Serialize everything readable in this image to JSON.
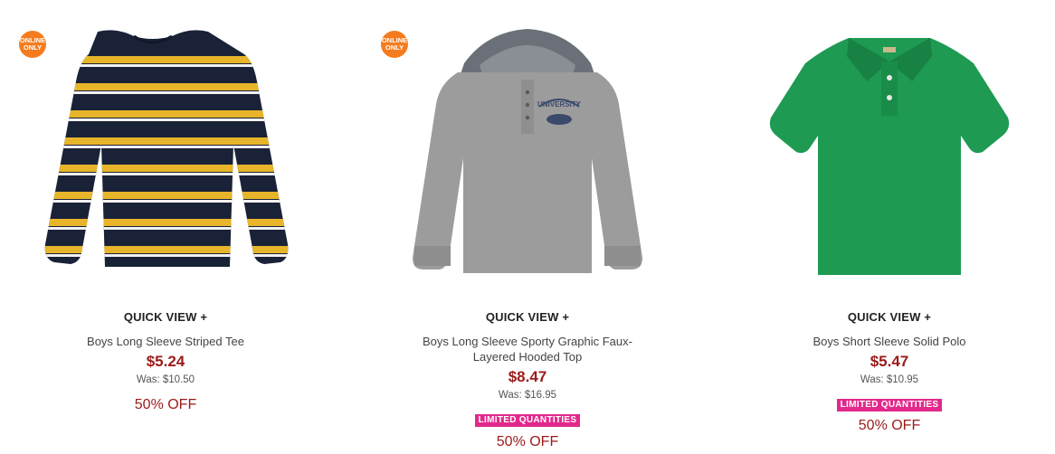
{
  "products": [
    {
      "online_only": "ONLINE ONLY",
      "badge_line1": "ONLINE",
      "badge_line2": "ONLY",
      "image": "navy-yellow-striped-long-sleeve-tee",
      "quick_view": "QUICK VIEW +",
      "name": "Boys Long Sleeve Striped Tee",
      "price": "$5.24",
      "was": "Was: $10.50",
      "discount": "50% OFF"
    },
    {
      "online_only": "ONLINE ONLY",
      "badge_line1": "ONLINE",
      "badge_line2": "ONLY",
      "image": "gray-hooded-henley-university-graphic",
      "graphic_text": "UNIVERSITY",
      "quick_view": "QUICK VIEW +",
      "name": "Boys Long Sleeve Sporty Graphic Faux-Layered Hooded Top",
      "price": "$8.47",
      "was": "Was: $16.95",
      "limited": "LIMITED QUANTITIES",
      "discount": "50% OFF"
    },
    {
      "image": "green-short-sleeve-polo",
      "quick_view": "QUICK VIEW +",
      "name": "Boys Short Sleeve Solid Polo",
      "price": "$5.47",
      "was": "Was: $10.95",
      "limited": "LIMITED QUANTITIES",
      "discount": "50% OFF"
    }
  ],
  "colors": {
    "price": "#9c1a1a",
    "limited_badge": "#e2298b",
    "online_badge": "#f47c1f",
    "navy": "#1a2238",
    "stripe_yellow": "#e8b52a",
    "heather_gray": "#9c9c9c",
    "polo_green": "#1e9a52"
  }
}
